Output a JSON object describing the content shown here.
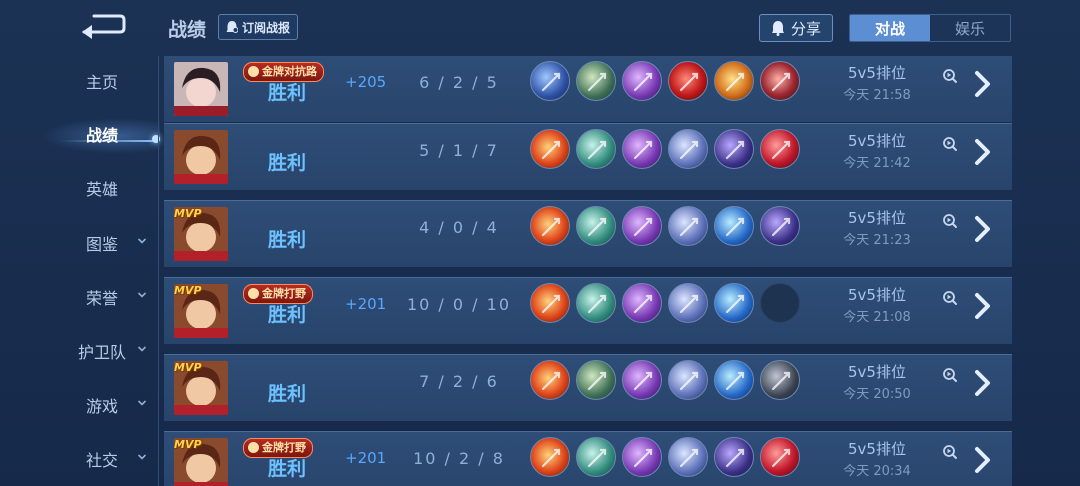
{
  "header": {
    "title": "战绩",
    "subscribe_label": "订阅战报",
    "share_label": "分享",
    "tabs": [
      {
        "label": "对战",
        "active": true
      },
      {
        "label": "娱乐",
        "active": false
      }
    ]
  },
  "sidebar": {
    "items": [
      {
        "label": "主页",
        "has_chevron": false
      },
      {
        "label": "战绩",
        "has_chevron": false,
        "active": true
      },
      {
        "label": "英雄",
        "has_chevron": false
      },
      {
        "label": "图鉴",
        "has_chevron": true
      },
      {
        "label": "荣誉",
        "has_chevron": true
      },
      {
        "label": "护卫队",
        "has_chevron": true
      },
      {
        "label": "游戏",
        "has_chevron": true
      },
      {
        "label": "社交",
        "has_chevron": true
      }
    ]
  },
  "matches": [
    {
      "result": "胜利",
      "mvp": false,
      "badge": "金牌对抗路",
      "score_change": "+205",
      "kda": "6 / 2 / 5",
      "mode": "5v5排位",
      "time": "今天 21:58",
      "items": [
        "blue-blade",
        "green-boots",
        "purple-axe",
        "red-orb",
        "gold-helmet",
        "red-gauntlet"
      ]
    },
    {
      "result": "胜利",
      "mvp": false,
      "badge": "",
      "score_change": "",
      "kda": "5 / 1 / 7",
      "mode": "5v5排位",
      "time": "今天 21:42",
      "items": [
        "fire-gauntlet",
        "teal-boots",
        "purple-axe",
        "blue-axe",
        "dark-trident",
        "red-gem"
      ]
    },
    {
      "result": "胜利",
      "mvp": true,
      "badge": "",
      "score_change": "",
      "kda": "4 / 0 / 4",
      "mode": "5v5排位",
      "time": "今天 21:23",
      "items": [
        "fire-gauntlet",
        "teal-boots",
        "purple-axe",
        "blue-axe",
        "blue-trident",
        "dark-trident"
      ]
    },
    {
      "result": "胜利",
      "mvp": true,
      "badge": "金牌打野",
      "score_change": "+201",
      "kda": "10 / 0 / 10",
      "mode": "5v5排位",
      "time": "今天 21:08",
      "items": [
        "fire-gauntlet",
        "teal-boots",
        "purple-axe",
        "blue-axe",
        "blue-trident",
        "empty"
      ]
    },
    {
      "result": "胜利",
      "mvp": true,
      "badge": "",
      "score_change": "",
      "kda": "7 / 2 / 6",
      "mode": "5v5排位",
      "time": "今天 20:50",
      "items": [
        "fire-gauntlet",
        "green-boots",
        "purple-axe",
        "blue-axe",
        "blue-trident",
        "dark-spear"
      ]
    },
    {
      "result": "胜利",
      "mvp": true,
      "badge": "金牌打野",
      "score_change": "+201",
      "kda": "10 / 2 / 8",
      "mode": "5v5排位",
      "time": "今天 20:34",
      "items": [
        "fire-gauntlet",
        "teal-boots",
        "purple-axe",
        "blue-axe",
        "dark-trident",
        "red-gem"
      ]
    }
  ],
  "colors": {
    "accent": "#5c8ed3",
    "result": "#6cc2ff",
    "badge": "#b62c22"
  },
  "icons": {
    "back": "back-arrow-icon",
    "share": "share-bell-icon",
    "replay": "replay-icon",
    "detail": "chevron-right-icon"
  }
}
